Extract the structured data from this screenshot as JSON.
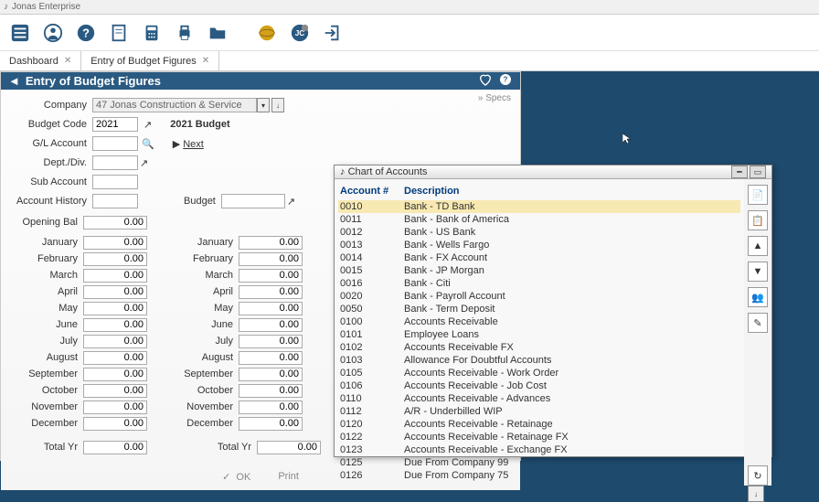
{
  "window_title": "Jonas Enterprise",
  "tabs": {
    "dashboard": "Dashboard",
    "budget": "Entry of Budget Figures"
  },
  "form": {
    "title": "Entry of Budget Figures",
    "company_label": "Company",
    "company_value": "47 Jonas Construction & Service",
    "budget_code_label": "Budget Code",
    "budget_code_value": "2021",
    "budget_code_desc": "2021 Budget",
    "gl_label": "G/L Account",
    "next": "Next",
    "dept_label": "Dept./Div.",
    "sub_label": "Sub Account",
    "acct_hist_label": "Account History",
    "budget_label": "Budget",
    "opening_bal_label": "Opening Bal",
    "opening_bal_value": "0.00",
    "total_yr_label": "Total Yr",
    "total_yr_value": "0.00",
    "specs": "» Specs",
    "ok": "OK",
    "print": "Print"
  },
  "months": [
    "January",
    "February",
    "March",
    "April",
    "May",
    "June",
    "July",
    "August",
    "September",
    "October",
    "November",
    "December"
  ],
  "month_value": "0.00",
  "popup": {
    "title": "Chart of Accounts",
    "col1": "Account #",
    "col2": "Description",
    "rows": [
      {
        "a": "0010",
        "d": "Bank - TD Bank"
      },
      {
        "a": "0011",
        "d": "Bank - Bank of America"
      },
      {
        "a": "0012",
        "d": "Bank - US Bank"
      },
      {
        "a": "0013",
        "d": "Bank - Wells Fargo"
      },
      {
        "a": "0014",
        "d": "Bank - FX Account"
      },
      {
        "a": "0015",
        "d": "Bank - JP Morgan"
      },
      {
        "a": "0016",
        "d": "Bank - Citi"
      },
      {
        "a": "0020",
        "d": "Bank - Payroll Account"
      },
      {
        "a": "0050",
        "d": "Bank - Term Deposit"
      },
      {
        "a": "0100",
        "d": "Accounts Receivable"
      },
      {
        "a": "0101",
        "d": "Employee Loans"
      },
      {
        "a": "0102",
        "d": "Accounts Receivable FX"
      },
      {
        "a": "0103",
        "d": "Allowance For Doubtful Accounts"
      },
      {
        "a": "0105",
        "d": "Accounts Receivable - Work Order"
      },
      {
        "a": "0106",
        "d": "Accounts Receivable - Job Cost"
      },
      {
        "a": "0110",
        "d": "Accounts Receivable - Advances"
      },
      {
        "a": "0112",
        "d": "A/R - Underbilled WIP"
      },
      {
        "a": "0120",
        "d": "Accounts Receivable - Retainage"
      },
      {
        "a": "0122",
        "d": "Accounts Receivable - Retainage FX"
      },
      {
        "a": "0123",
        "d": "Accounts Receivable - Exchange FX"
      },
      {
        "a": "0125",
        "d": "Due From Company 99"
      },
      {
        "a": "0126",
        "d": "Due From Company 75"
      }
    ]
  }
}
